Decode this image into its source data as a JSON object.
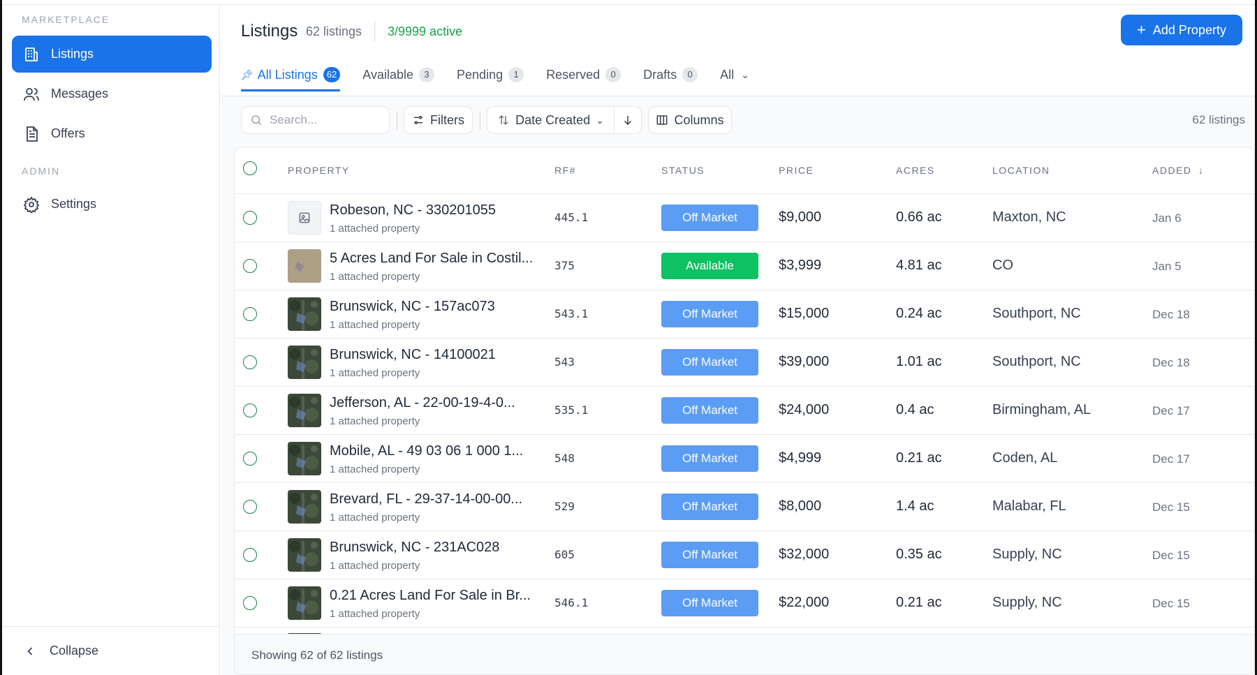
{
  "sidebar": {
    "marketplace_label": "MARKETPLACE",
    "admin_label": "ADMIN",
    "items": [
      {
        "label": "Listings",
        "icon": "building-icon",
        "active": true
      },
      {
        "label": "Messages",
        "icon": "users-icon",
        "active": false
      },
      {
        "label": "Offers",
        "icon": "document-icon",
        "active": false
      }
    ],
    "admin_items": [
      {
        "label": "Settings",
        "icon": "gear-icon"
      }
    ],
    "collapse_label": "Collapse"
  },
  "header": {
    "title": "Listings",
    "count": "62 listings",
    "active": "3/9999 active",
    "add_button": "Add Property"
  },
  "tabs": [
    {
      "label": "All Listings",
      "badge": "62",
      "active": true
    },
    {
      "label": "Available",
      "badge": "3"
    },
    {
      "label": "Pending",
      "badge": "1"
    },
    {
      "label": "Reserved",
      "badge": "0"
    },
    {
      "label": "Drafts",
      "badge": "0"
    },
    {
      "label": "All"
    }
  ],
  "toolbar": {
    "search_placeholder": "Search...",
    "filters": "Filters",
    "sort": "Date Created",
    "columns": "Columns",
    "listings_count": "62 listings"
  },
  "table": {
    "columns": [
      "PROPERTY",
      "RF#",
      "STATUS",
      "PRICE",
      "ACRES",
      "LOCATION",
      "ADDED"
    ],
    "rows": [
      {
        "name": "Robeson, NC - 330201055",
        "sub": "1 attached property",
        "rf": "445.1",
        "status": "Off Market",
        "price": "$9,000",
        "acres": "0.66 ac",
        "location": "Maxton, NC",
        "added": "Jan 6",
        "thumb": "placeholder"
      },
      {
        "name": "5 Acres Land For Sale in Costil...",
        "sub": "1 attached property",
        "rf": "375",
        "status": "Available",
        "price": "$3,999",
        "acres": "4.81 ac",
        "location": "CO",
        "added": "Jan 5",
        "thumb": "desert"
      },
      {
        "name": "Brunswick, NC - 157ac073",
        "sub": "1 attached property",
        "rf": "543.1",
        "status": "Off Market",
        "price": "$15,000",
        "acres": "0.24 ac",
        "location": "Southport, NC",
        "added": "Dec 18",
        "thumb": "aerial"
      },
      {
        "name": "Brunswick, NC - 14100021",
        "sub": "1 attached property",
        "rf": "543",
        "status": "Off Market",
        "price": "$39,000",
        "acres": "1.01 ac",
        "location": "Southport, NC",
        "added": "Dec 18",
        "thumb": "aerial"
      },
      {
        "name": "Jefferson, AL - 22-00-19-4-0...",
        "sub": "1 attached property",
        "rf": "535.1",
        "status": "Off Market",
        "price": "$24,000",
        "acres": "0.4 ac",
        "location": "Birmingham, AL",
        "added": "Dec 17",
        "thumb": "aerial"
      },
      {
        "name": "Mobile, AL - 49 03 06 1 000 1...",
        "sub": "1 attached property",
        "rf": "548",
        "status": "Off Market",
        "price": "$4,999",
        "acres": "0.21 ac",
        "location": "Coden, AL",
        "added": "Dec 17",
        "thumb": "aerial"
      },
      {
        "name": "Brevard, FL - 29-37-14-00-00...",
        "sub": "1 attached property",
        "rf": "529",
        "status": "Off Market",
        "price": "$8,000",
        "acres": "1.4 ac",
        "location": "Malabar, FL",
        "added": "Dec 15",
        "thumb": "aerial"
      },
      {
        "name": "Brunswick, NC - 231AC028",
        "sub": "1 attached property",
        "rf": "605",
        "status": "Off Market",
        "price": "$32,000",
        "acres": "0.35 ac",
        "location": "Supply, NC",
        "added": "Dec 15",
        "thumb": "aerial"
      },
      {
        "name": "0.21 Acres Land For Sale in Br...",
        "sub": "1 attached property",
        "rf": "546.1",
        "status": "Off Market",
        "price": "$22,000",
        "acres": "0.21 ac",
        "location": "Supply, NC",
        "added": "Dec 15",
        "thumb": "aerial"
      }
    ],
    "footer": "Showing 62 of 62 listings"
  },
  "colors": {
    "accent": "#1a73e8",
    "off_market": "#5b9cf5",
    "available": "#0ec163",
    "active_green": "#16a34a"
  }
}
